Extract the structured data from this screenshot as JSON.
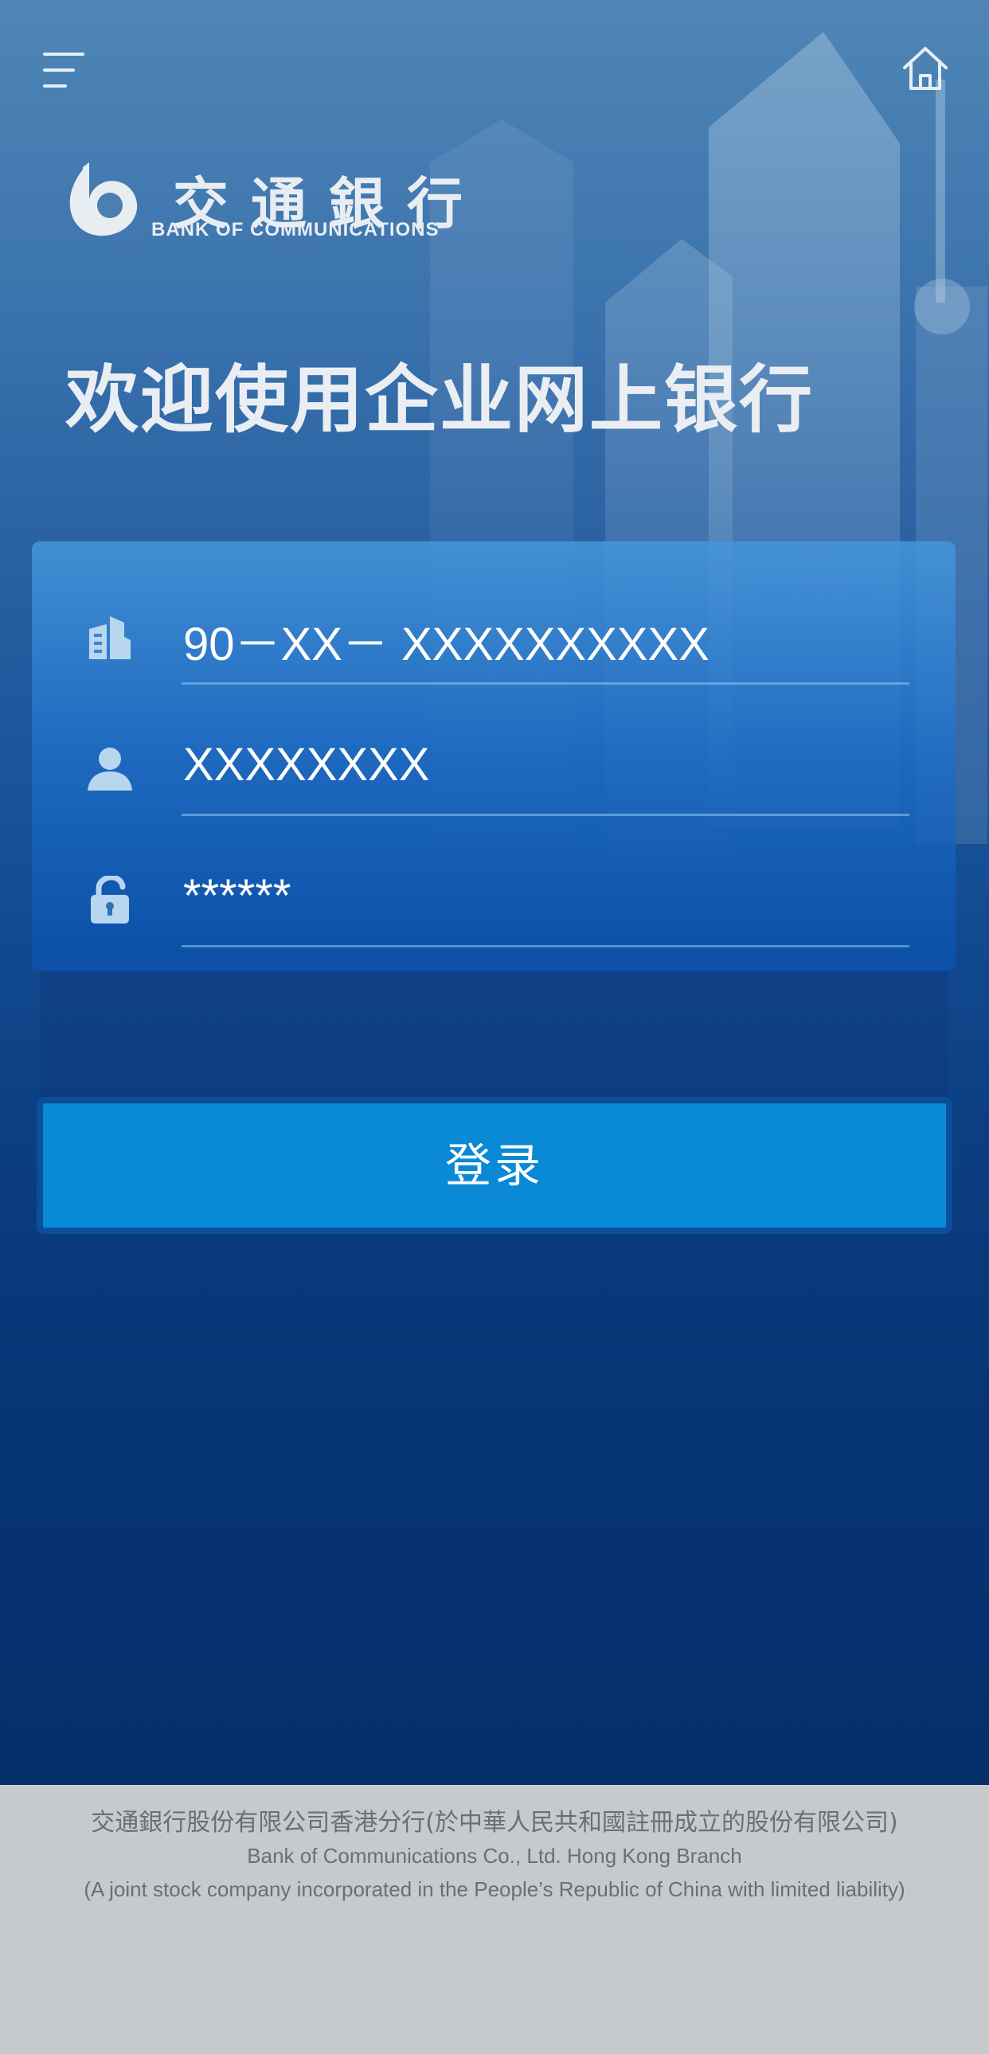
{
  "header": {
    "menu_icon": "hamburger-menu-icon",
    "home_icon": "home-icon"
  },
  "logo": {
    "name_cn": "交通銀行",
    "name_en": "BANK OF COMMUNICATIONS"
  },
  "welcome_title": "欢迎使用企业网上银行",
  "form": {
    "account": {
      "icon": "building-icon",
      "value": "90－XX－ XXXXXXXXXX"
    },
    "username": {
      "icon": "user-icon",
      "value": "XXXXXXXX"
    },
    "password": {
      "icon": "unlock-icon",
      "value": "******"
    }
  },
  "login_button": "登录",
  "footer": {
    "line_cn": "交通銀行股份有限公司香港分行(於中華人民共和國註冊成立的股份有限公司)",
    "line_en": "Bank of Communications Co., Ltd. Hong Kong Branch",
    "line_note": "(A joint stock company incorporated in the People’s Republic of China with limited liability)"
  },
  "colors": {
    "accent": "#0989d6",
    "background_top": "#4f86b6",
    "background_bottom": "#052e6b",
    "footer_bg": "#c7cacd"
  }
}
